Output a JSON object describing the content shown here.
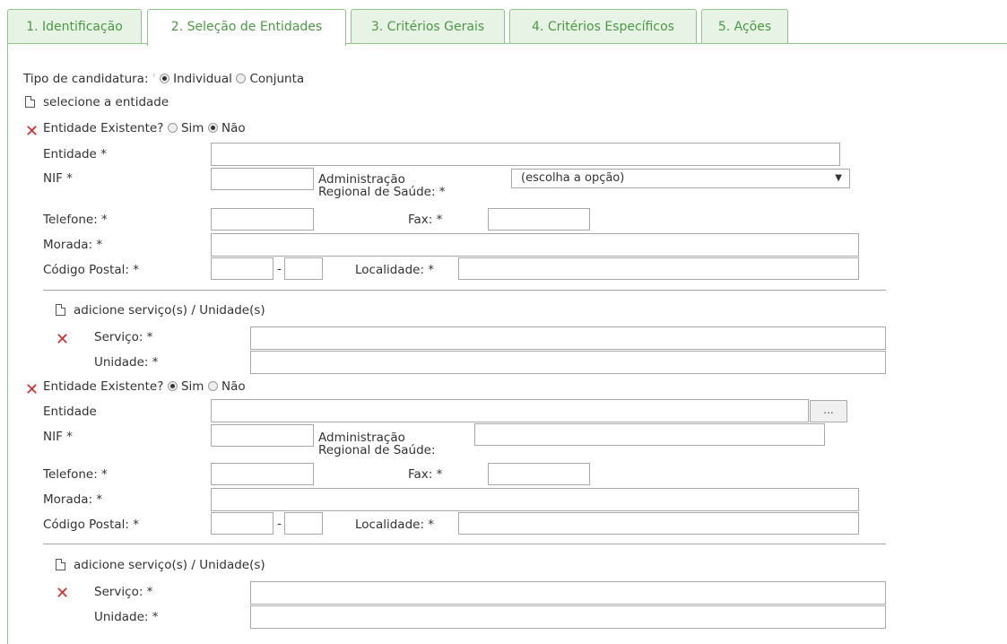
{
  "tabs": [
    {
      "label": "1. Identificação"
    },
    {
      "label": "2. Seleção de Entidades"
    },
    {
      "label": "3. Critérios Gerais"
    },
    {
      "label": "4. Critérios Específicos"
    },
    {
      "label": "5. Ações"
    }
  ],
  "candidatura": {
    "label": "Tipo de candidatura:",
    "options": [
      "Individual",
      "Conjunta"
    ],
    "selected": "Individual"
  },
  "select_entity_label": "selecione a entidade",
  "entity1": {
    "existente_label": "Entidade Existente?",
    "sim": "Sim",
    "nao": "Não",
    "selected": "Não",
    "entidade_label": "Entidade *",
    "nif_label": "NIF *",
    "ars_label": "Administração Regional de Saúde: *",
    "ars_line1": "Administração",
    "ars_line2": "Regional de Saúde: *",
    "ars_select": "(escolha a opção)",
    "telefone_label": "Telefone: *",
    "fax_label": "Fax: *",
    "morada_label": "Morada: *",
    "cp_label": "Código Postal: *",
    "cp_sep": "-",
    "localidade_label": "Localidade: *",
    "servicos_label": "adicione serviço(s) / Unidade(s)",
    "servico_label": "Serviço: *",
    "unidade_label": "Unidade: *"
  },
  "entity2": {
    "existente_label": "Entidade Existente?",
    "sim": "Sim",
    "nao": "Não",
    "selected": "Sim",
    "entidade_label": "Entidade",
    "browse_label": "...",
    "nif_label": "NIF *",
    "ars_line1": "Administração",
    "ars_line2": "Regional de Saúde:",
    "telefone_label": "Telefone: *",
    "fax_label": "Fax: *",
    "morada_label": "Morada: *",
    "cp_label": "Código Postal: *",
    "cp_sep": "-",
    "localidade_label": "Localidade: *",
    "servicos_label": "adicione serviço(s) / Unidade(s)",
    "servico_label": "Serviço: *",
    "unidade_label": "Unidade: *"
  },
  "colors": {
    "tab_green": "#4a9a42",
    "tab_bg": "#e7f3e5",
    "remove_red": "#d92b2b"
  }
}
